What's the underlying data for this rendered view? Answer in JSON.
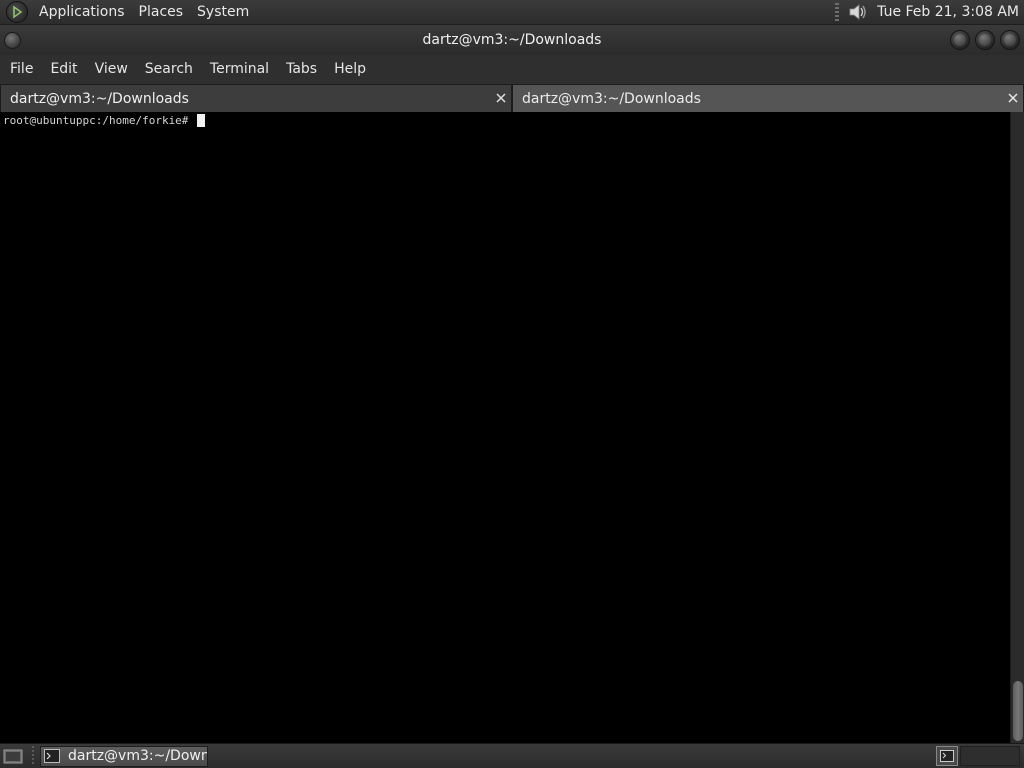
{
  "top_panel": {
    "menus": [
      "Applications",
      "Places",
      "System"
    ],
    "clock": "Tue Feb 21,  3:08 AM",
    "icons": [
      "distro-logo-icon",
      "volume-icon"
    ]
  },
  "window": {
    "title": "dartz@vm3:~/Downloads"
  },
  "menubar": {
    "items": [
      "File",
      "Edit",
      "View",
      "Search",
      "Terminal",
      "Tabs",
      "Help"
    ]
  },
  "tabs": [
    {
      "label": "dartz@vm3:~/Downloads",
      "active": true
    },
    {
      "label": "dartz@vm3:~/Downloads",
      "active": false
    }
  ],
  "terminal": {
    "prompt": "root@ubuntuppc:/home/forkie#"
  },
  "taskbar": {
    "task_label": "dartz@vm3:~/Down..."
  },
  "colors": {
    "panel": "#2f2f2f",
    "terminal_bg": "#000000",
    "terminal_fg": "#d4d4d4",
    "tab_active": "#3d3d3d",
    "tab_inactive": "#555555"
  }
}
